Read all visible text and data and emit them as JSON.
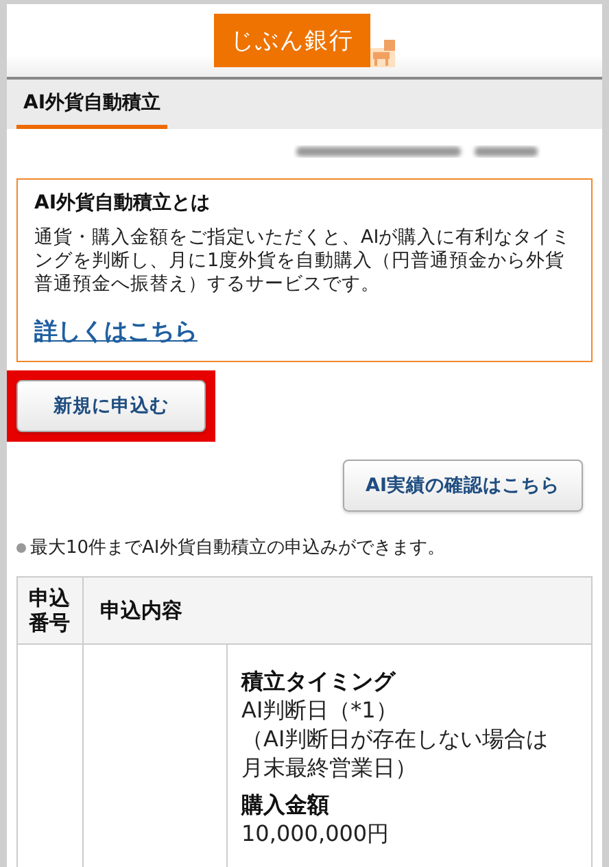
{
  "header": {
    "logo": "じぶん銀行"
  },
  "tabs": [
    {
      "label": "AI外貨自動積立",
      "selected": true
    }
  ],
  "info": {
    "title": "AI外貨自動積立とは",
    "body": "通貨・購入金額をご指定いただくと、AIが購入に有利なタイミングを判断し、月に1度外貨を自動購入（円普通預金から外貨普通預金へ振替え）するサービスです。",
    "link": "詳しくはこちら"
  },
  "buttons": [
    {
      "label": "新規に申込む",
      "highlighted": true
    },
    {
      "label": "AI実績の確認はこちら",
      "highlighted": false
    }
  ],
  "note": "最大10件までAI外貨自動積立の申込みができます。",
  "table": {
    "columns": [
      "申込番号",
      "申込内容"
    ],
    "rows": [
      {
        "details": [
          {
            "label": "積立タイミング",
            "lines": [
              "AI判断日（*1）",
              "（AI判断日が存在しない場合は月末最終営業日）"
            ]
          },
          {
            "label": "購入金額",
            "lines": [
              "10,000,000円"
            ]
          }
        ]
      }
    ]
  }
}
